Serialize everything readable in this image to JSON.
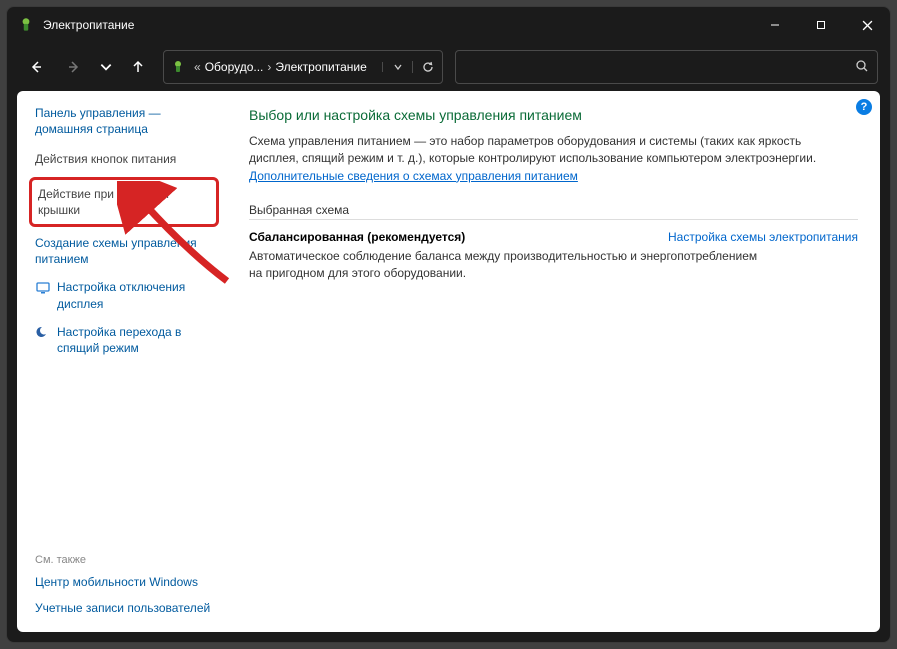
{
  "window": {
    "title": "Электропитание"
  },
  "breadcrumb": {
    "ellipsis": "«",
    "part1": "Оборудо...",
    "sep": "›",
    "part2": "Электропитание"
  },
  "sidebar": {
    "home": "Панель управления — домашняя страница",
    "link_buttons": "Действия кнопок питания",
    "link_lid": "Действие при закрытии крышки",
    "link_create": "Создание схемы управления питанием",
    "link_display": "Настройка отключения дисплея",
    "link_sleep": "Настройка перехода в спящий режим",
    "seealso": "См. также",
    "link_mobility": "Центр мобильности Windows",
    "link_accounts": "Учетные записи пользователей"
  },
  "main": {
    "heading": "Выбор или настройка схемы управления питанием",
    "description": "Схема управления питанием — это набор параметров оборудования и системы (таких как яркость дисплея, спящий режим и т. д.), которые контролируют использование компьютером электроэнергии.",
    "more_link": "Дополнительные сведения о схемах управления питанием",
    "section_selected": "Выбранная схема",
    "plan_name": "Сбалансированная (рекомендуется)",
    "plan_action": "Настройка схемы электропитания",
    "plan_desc": "Автоматическое соблюдение баланса между производительностью и энергопотреблением на пригодном для этого оборудовании."
  },
  "help": "?"
}
